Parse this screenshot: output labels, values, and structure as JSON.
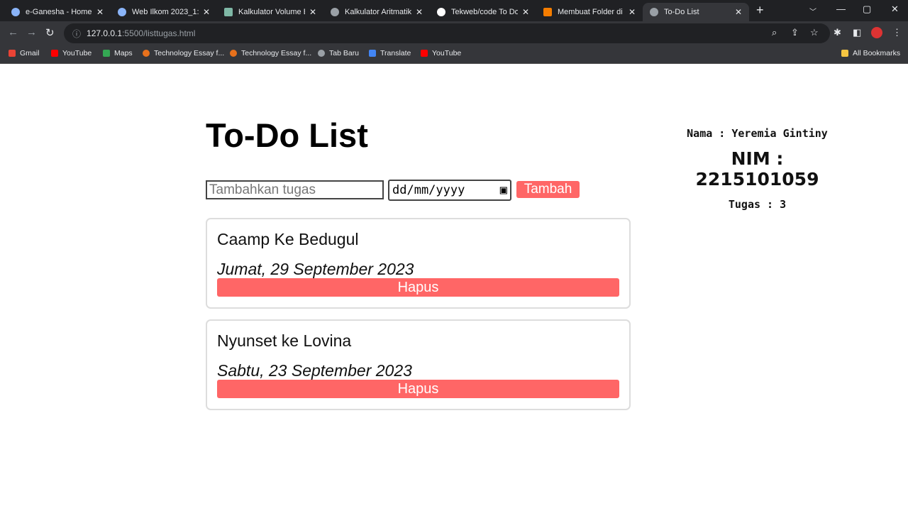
{
  "browser": {
    "tabs": [
      {
        "label": "e-Ganesha - Home"
      },
      {
        "label": "Web Ilkom 2023_1: Tu"
      },
      {
        "label": "Kalkulator Volume Ba"
      },
      {
        "label": "Kalkulator Aritmatika"
      },
      {
        "label": "Tekweb/code To Do Li"
      },
      {
        "label": "Membuat Folder di R"
      },
      {
        "label": "To-Do List"
      }
    ],
    "url_host": "127.0.0.1",
    "url_path": ":5500/listtugas.html",
    "bookmarks": [
      {
        "label": "Gmail",
        "color": "#ea4335"
      },
      {
        "label": "YouTube",
        "color": "#ff0000"
      },
      {
        "label": "Maps",
        "color": "#34a853"
      },
      {
        "label": "Technology Essay f...",
        "color": "#e8711c"
      },
      {
        "label": "Technology Essay f...",
        "color": "#e8711c"
      },
      {
        "label": "Tab Baru",
        "color": "#9aa0a6"
      },
      {
        "label": "Translate",
        "color": "#4285f4"
      },
      {
        "label": "YouTube",
        "color": "#ff0000"
      }
    ],
    "all_bookmarks": "All Bookmarks"
  },
  "app": {
    "title": "To-Do List",
    "input_placeholder": "Tambahkan tugas",
    "date_placeholder": "dd/mm/yyyy",
    "add_label": "Tambah",
    "tasks": [
      {
        "name": "Caamp Ke Bedugul",
        "date": "Jumat, 29 September 2023",
        "delete": "Hapus"
      },
      {
        "name": "Nyunset ke Lovina",
        "date": "Sabtu, 23 September 2023",
        "delete": "Hapus"
      }
    ],
    "nama": "Nama : Yeremia Gintiny",
    "nim": "NIM : 2215101059",
    "count": "Tugas : 3"
  },
  "accent": "#ff6666"
}
